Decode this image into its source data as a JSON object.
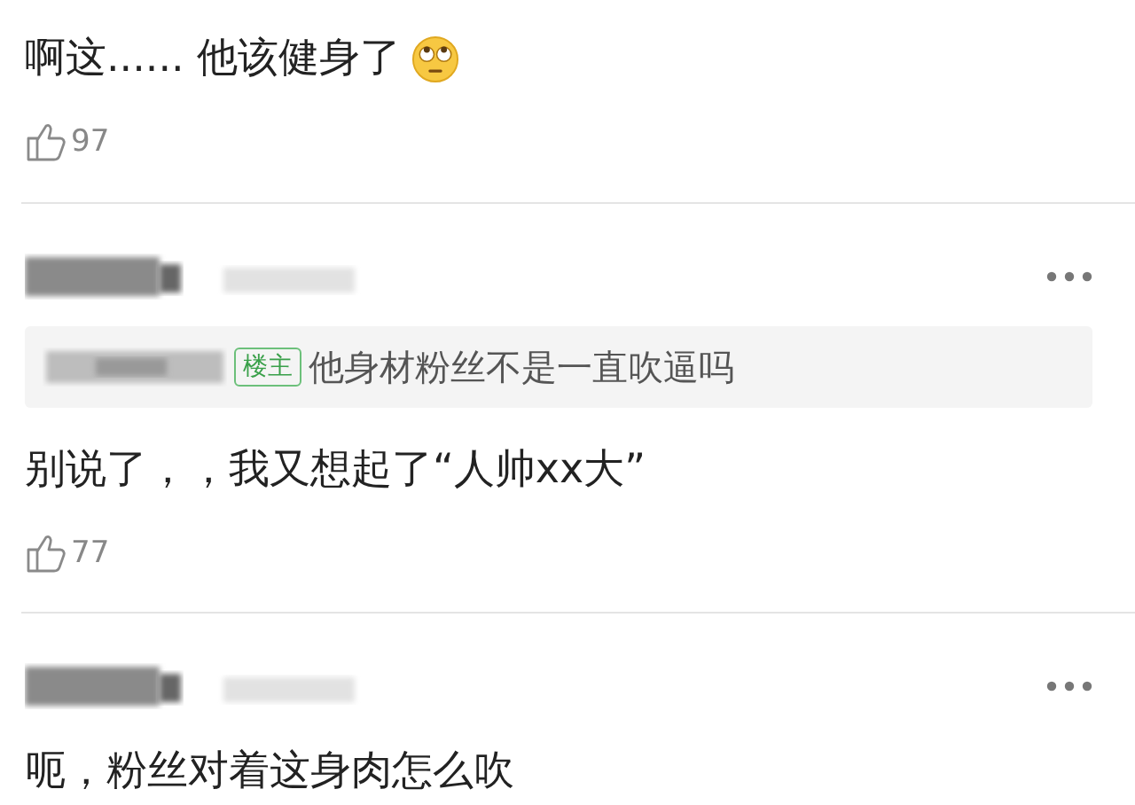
{
  "comments": [
    {
      "kind": "continued",
      "text": "啊这...... 他该健身了",
      "emoji_after": true,
      "likes": "97"
    },
    {
      "kind": "full",
      "quote": {
        "badge": "楼主",
        "text": "他身材粉丝不是一直吹逼吗"
      },
      "text": "别说了，，我又想起了“人帅xx大”",
      "likes": "77"
    },
    {
      "kind": "full",
      "text": "呃，粉丝对着这身肉怎么吹"
    }
  ]
}
